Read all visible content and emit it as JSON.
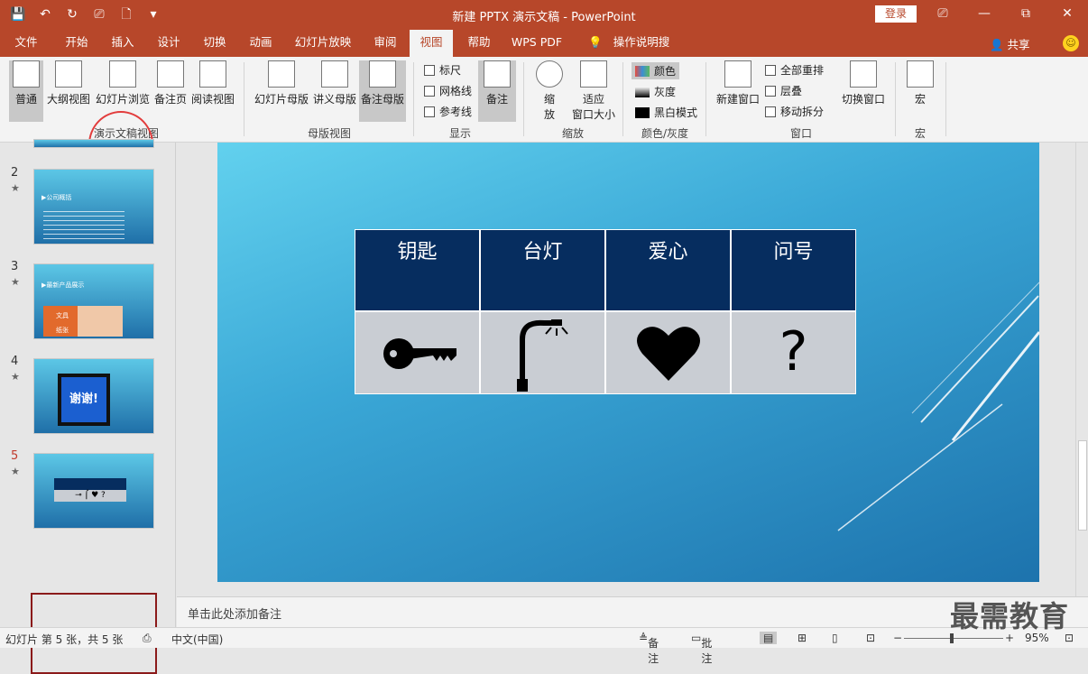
{
  "app": {
    "title": "新建 PPTX 演示文稿 - PowerPoint",
    "login": "登录",
    "share": "共享"
  },
  "qat": {
    "save": "💾",
    "undo": "↶",
    "redo": "↻",
    "present": "⎚",
    "new": "🗋",
    "more": "▾"
  },
  "window": {
    "min": "—",
    "restore": "⧉",
    "close": "✕",
    "ribbon_toggle": "⎚"
  },
  "tabs": [
    "文件",
    "开始",
    "插入",
    "设计",
    "切换",
    "动画",
    "幻灯片放映",
    "审阅",
    "视图",
    "帮助",
    "WPS PDF",
    "操作说明搜索"
  ],
  "ribbon": {
    "presentation_views": {
      "group": "演示文稿视图",
      "normal": "普通",
      "outline": "大纲视图",
      "sorter": "幻灯片浏览",
      "notes_page": "备注页",
      "reading": "阅读视图"
    },
    "master_views": {
      "group": "母版视图",
      "slide_master": "幻灯片母版",
      "handout_master": "讲义母版",
      "notes_master": "备注母版"
    },
    "show": {
      "group": "显示",
      "ruler": "标尺",
      "gridlines": "网格线",
      "guides": "参考线",
      "notes": "备注"
    },
    "zoom": {
      "group": "缩放",
      "zoom": "缩\n放",
      "fit": "适应\n窗口大小"
    },
    "color": {
      "group": "颜色/灰度",
      "color": "颜色",
      "grayscale": "灰度",
      "bw": "黑白模式"
    },
    "window": {
      "group": "窗口",
      "new_window": "新建窗口",
      "arrange_all": "全部重排",
      "cascade": "层叠",
      "move_split": "移动拆分",
      "switch": "切换窗口"
    },
    "macros": {
      "group": "宏",
      "macros": "宏"
    }
  },
  "slides": [
    {
      "num": "2",
      "star": "★",
      "title": "▶公司概括"
    },
    {
      "num": "3",
      "star": "★",
      "title": "▶最新产品展示",
      "row1": "文具",
      "row2": "纸张"
    },
    {
      "num": "4",
      "star": "★",
      "text": "谢谢!"
    },
    {
      "num": "5",
      "star": "★"
    }
  ],
  "slide": {
    "headers": [
      "钥匙",
      "台灯",
      "爱心",
      "问号"
    ],
    "icons": [
      "key-icon",
      "lamp-icon",
      "heart-icon",
      "question-icon"
    ],
    "question": "?"
  },
  "notes": {
    "placeholder": "单击此处添加备注"
  },
  "status": {
    "slide_info": "幻灯片 第 5 张，共 5 张",
    "lang": "中文(中国)",
    "notes": "备注",
    "comments": "批注",
    "zoom": "95%",
    "minus": "−",
    "plus": "+"
  },
  "watermark": "最需教育",
  "colors": {
    "accent": "#b7472a",
    "table_header": "#062d5f",
    "table_body": "#c9cdd3"
  }
}
